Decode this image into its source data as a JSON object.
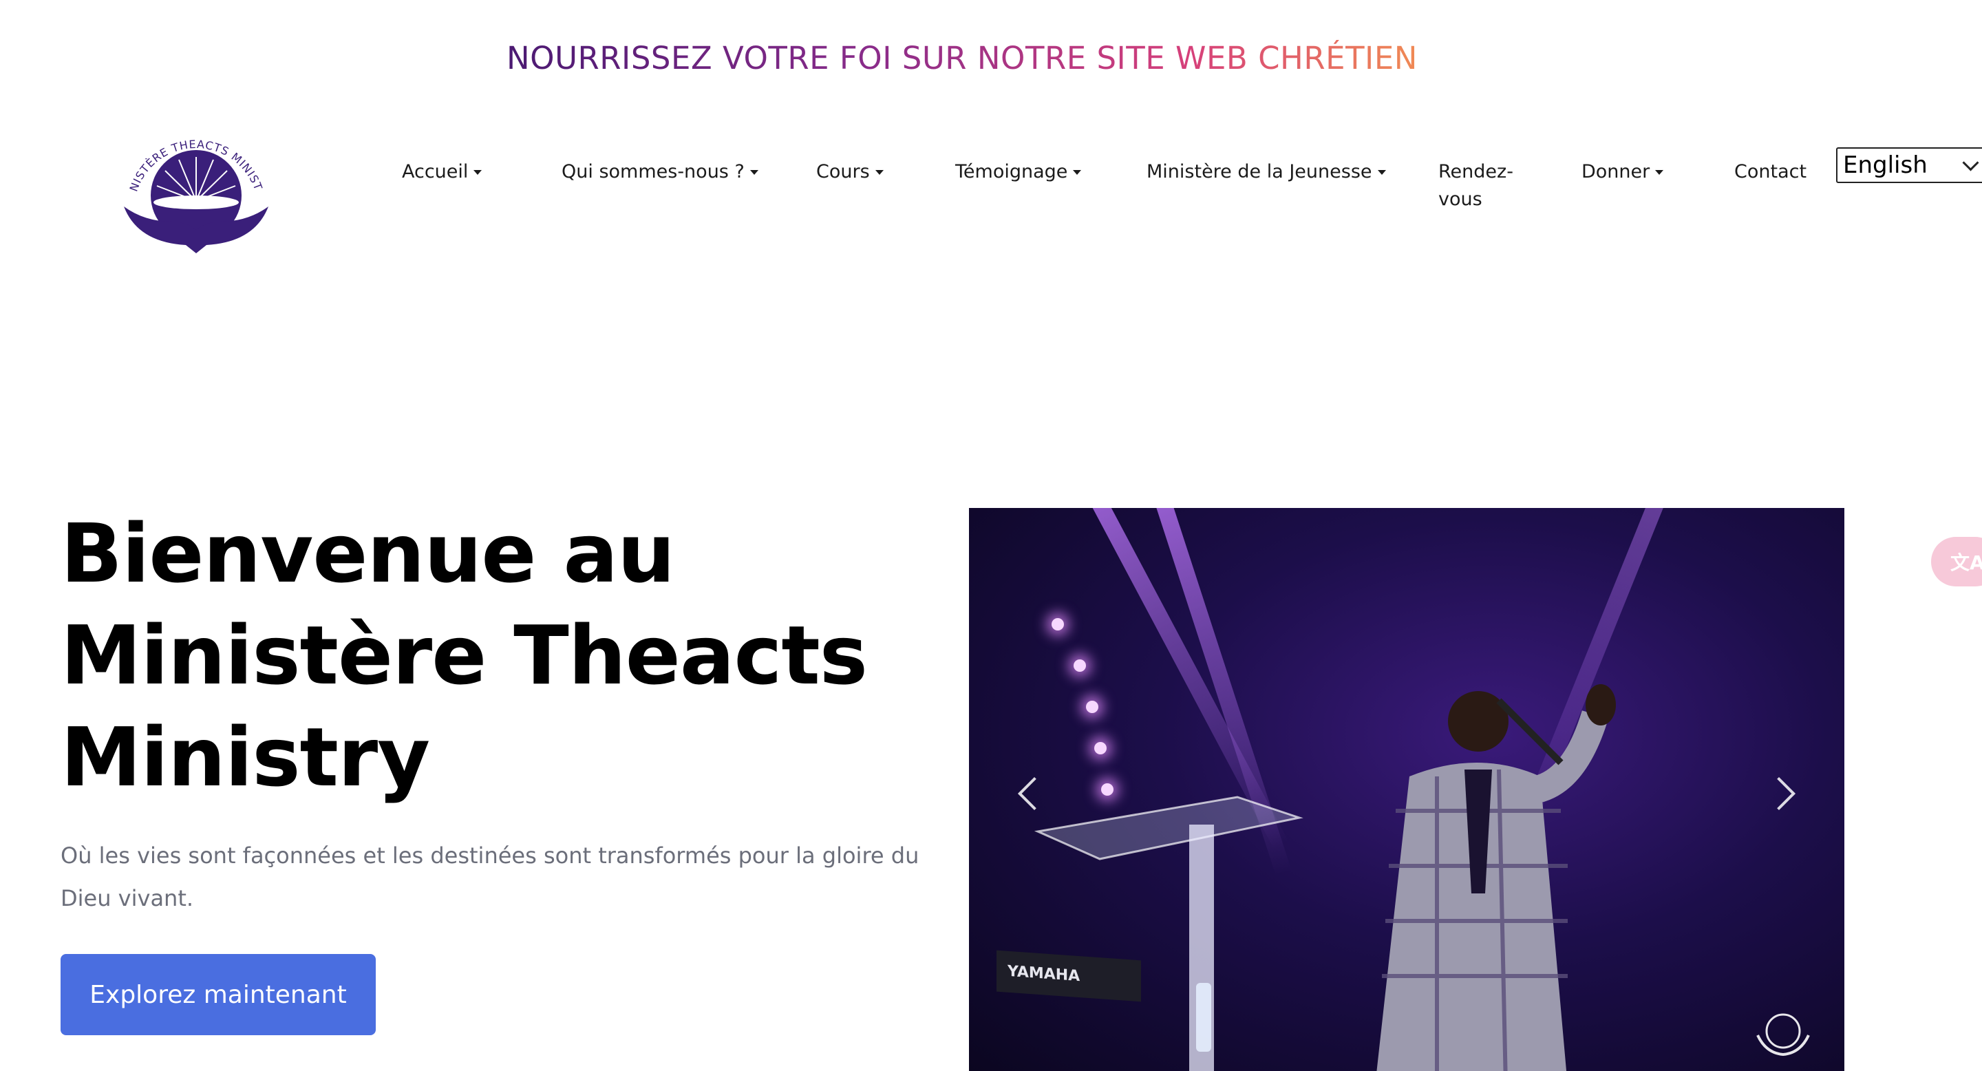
{
  "header": {
    "tagline": "NOURRISSEZ VOTRE FOI SUR NOTRE SITE WEB CHRÉTIEN",
    "logo_text": "MINISTÈRE THEACTS MINISTRY"
  },
  "nav": {
    "items": [
      {
        "label": "Accueil",
        "dropdown": true
      },
      {
        "label": "Qui sommes-nous ?",
        "dropdown": true
      },
      {
        "label": "Cours",
        "dropdown": true
      },
      {
        "label": "Témoignage",
        "dropdown": true
      },
      {
        "label": "Ministère de la Jeunesse",
        "dropdown": true
      },
      {
        "label_line1": "Rendez-",
        "label_line2": "vous",
        "dropdown": false
      },
      {
        "label": "Donner",
        "dropdown": true
      },
      {
        "label": "Contact",
        "dropdown": false
      }
    ],
    "language": {
      "selected": "English"
    }
  },
  "hero": {
    "title_line1": "Bienvenue au",
    "title_line2": "Ministère Theacts",
    "title_line3": "Ministry",
    "subtitle": "Où les vies sont façonnées et les destinées sont transformés pour la gloire du Dieu vivant.",
    "cta_label": "Explorez maintenant"
  },
  "carousel": {
    "keyboard_brand": "YAMAHA"
  },
  "translate_widget": {
    "icon": "translate-icon",
    "glyph": "文A"
  },
  "colors": {
    "tagline_start": "#4b1a72",
    "tagline_end": "#f08a54",
    "logo_purple": "#3a1f7a",
    "cta_blue": "#4a6ee0",
    "subtitle_gray": "#6b6e7a"
  }
}
